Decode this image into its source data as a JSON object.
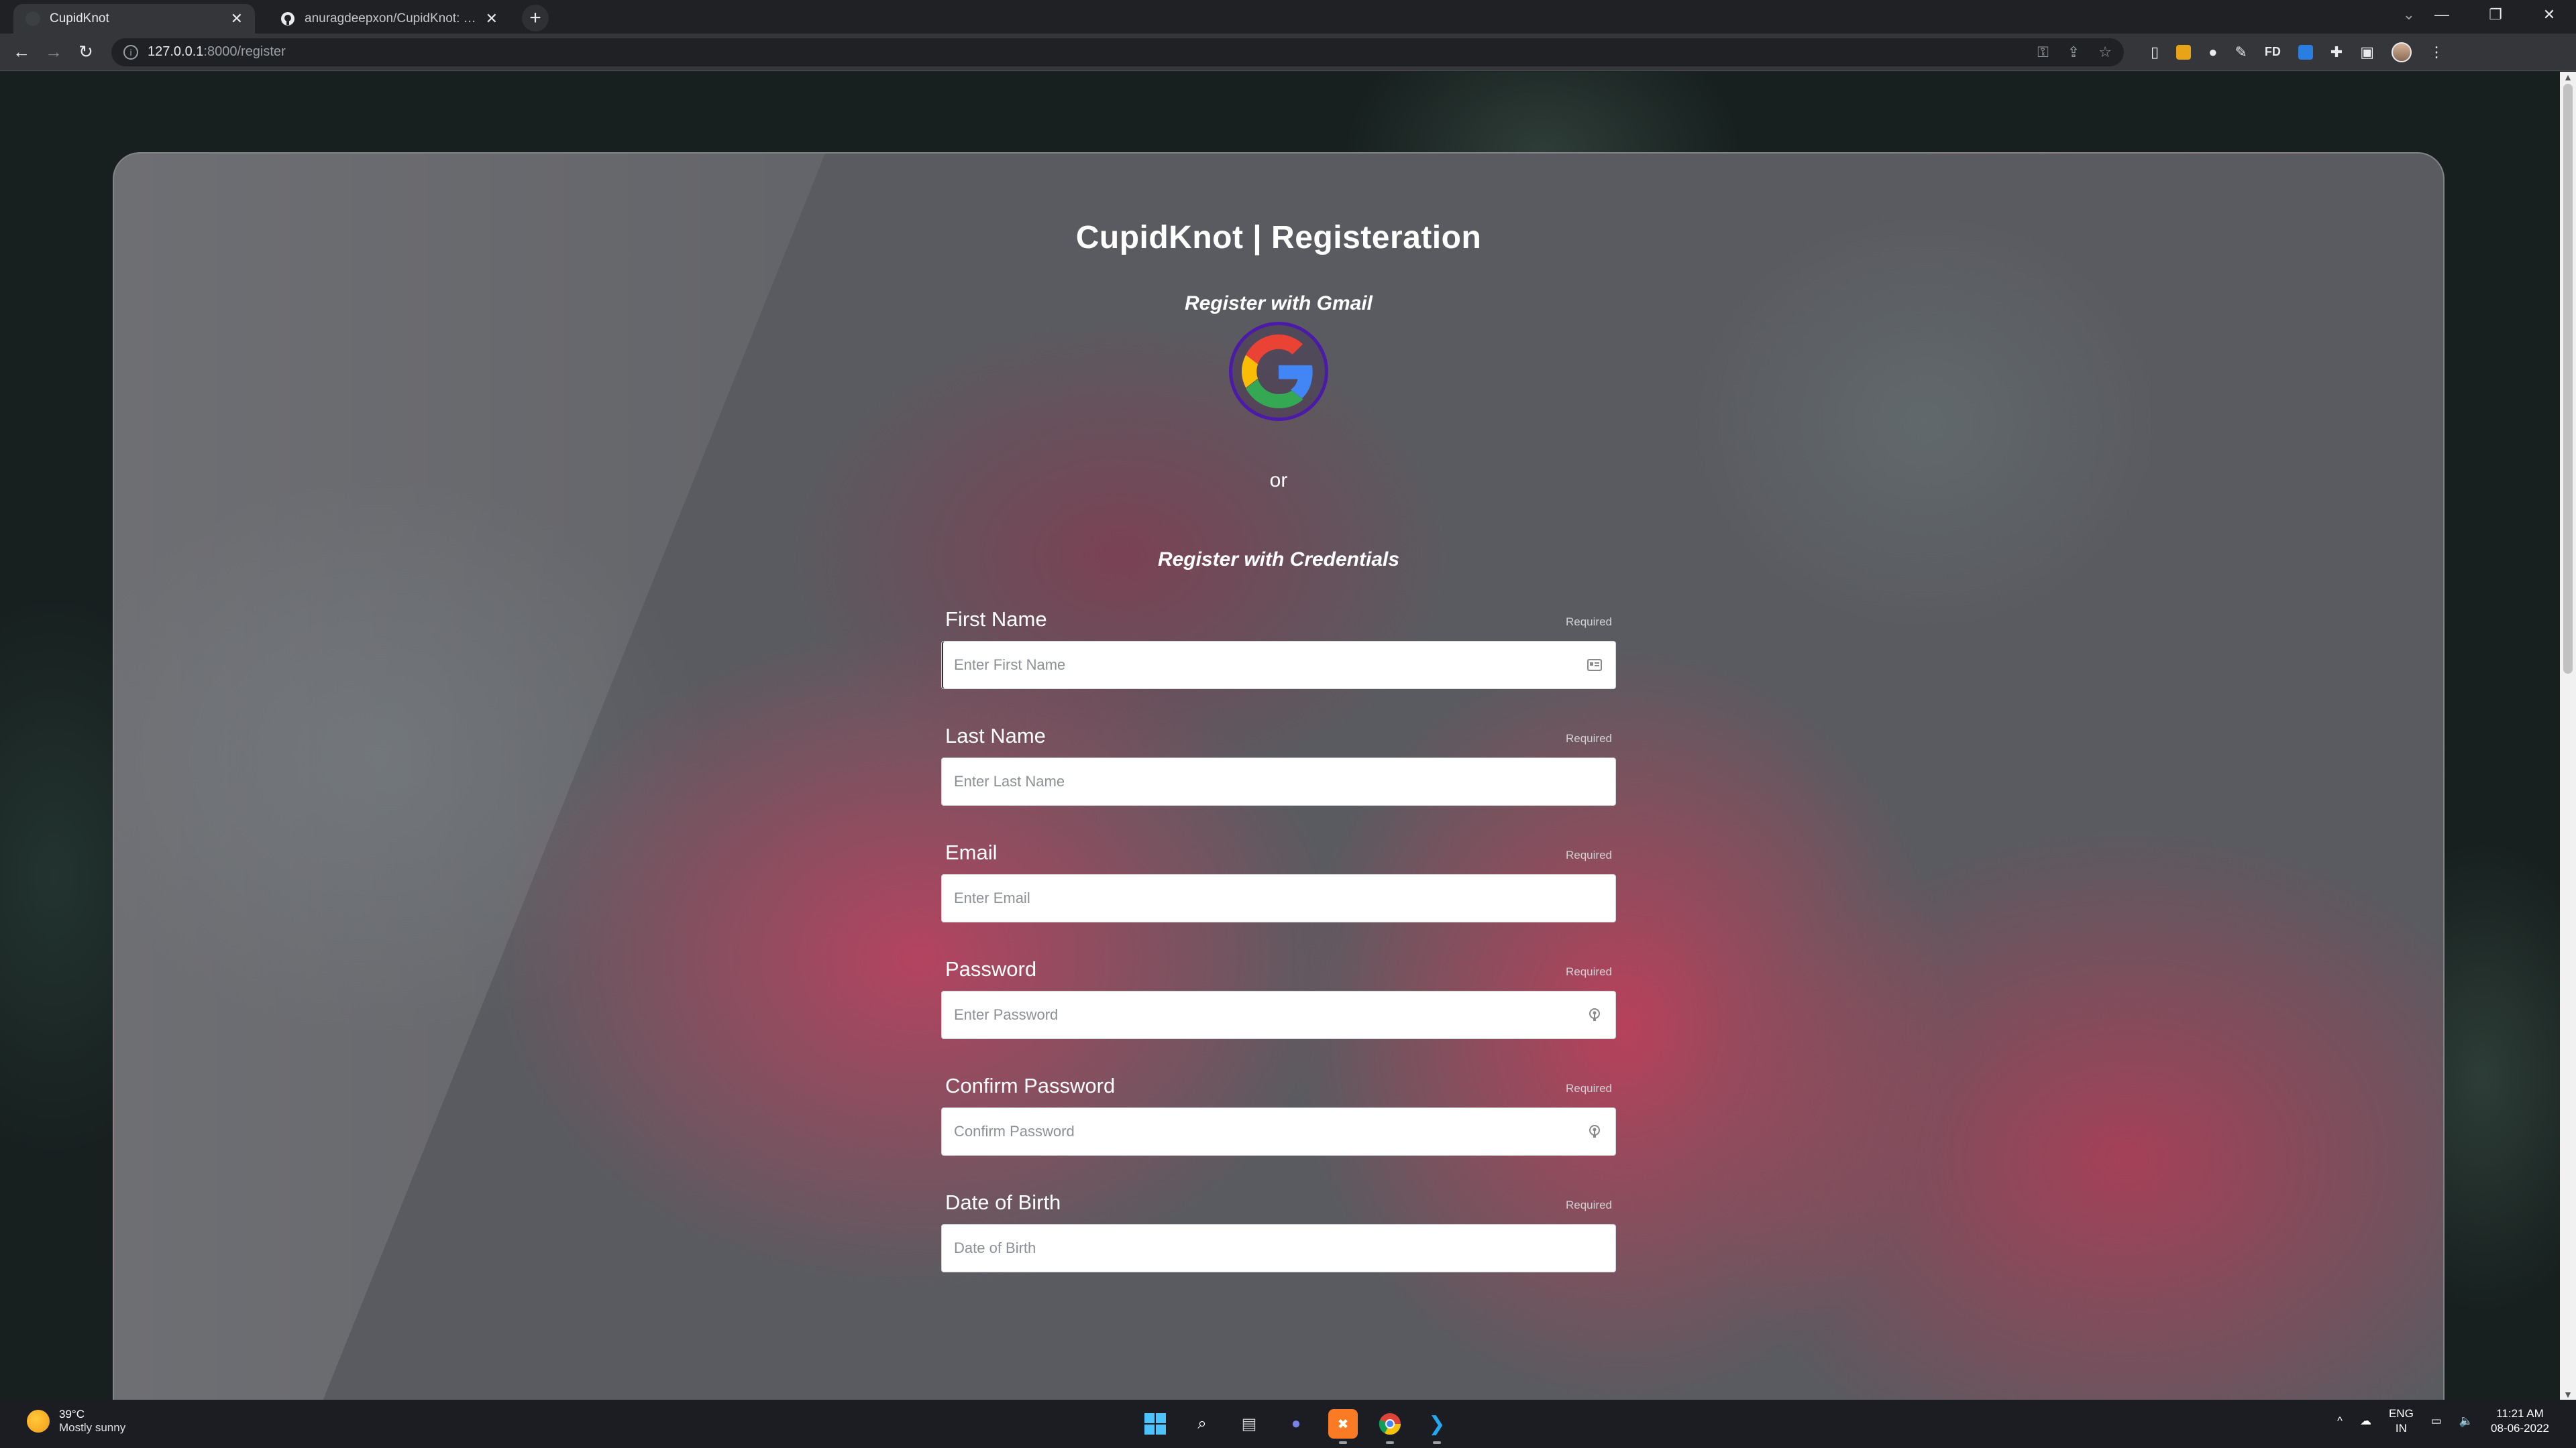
{
  "browser": {
    "tabs": [
      {
        "title": "CupidKnot",
        "active": true
      },
      {
        "title": "anuragdeepxon/CupidKnot: Cup",
        "active": false
      }
    ],
    "new_tab_symbol": "+",
    "url_host": "127.0.0.1",
    "url_path": ":8000/register",
    "window_controls": {
      "minimize": "—",
      "restore": "❐",
      "close": "✕"
    },
    "tab_search": "⌄"
  },
  "page": {
    "title": "CupidKnot | Registeration",
    "gmail_label": "Register with Gmail",
    "or_text": "or",
    "credentials_label": "Register with Credentials",
    "fields": [
      {
        "label": "First Name",
        "required": "Required",
        "placeholder": "Enter First Name",
        "icon": "contact-card-icon"
      },
      {
        "label": "Last Name",
        "required": "Required",
        "placeholder": "Enter Last Name",
        "icon": ""
      },
      {
        "label": "Email",
        "required": "Required",
        "placeholder": "Enter Email",
        "icon": ""
      },
      {
        "label": "Password",
        "required": "Required",
        "placeholder": "Enter Password",
        "icon": "key-icon"
      },
      {
        "label": "Confirm Password",
        "required": "Required",
        "placeholder": "Confirm Password",
        "icon": "key-icon"
      },
      {
        "label": "Date of Birth",
        "required": "Required",
        "placeholder": "Date of Birth",
        "icon": ""
      }
    ]
  },
  "taskbar": {
    "weather_temp": "39°C",
    "weather_desc": "Mostly sunny",
    "lang_1": "ENG",
    "lang_2": "IN",
    "time": "11:21 AM",
    "date": "08-06-2022"
  },
  "colors": {
    "google_ring": "#4b1aa8",
    "chrome_dark": "#202124",
    "toolbar": "#35363a"
  }
}
